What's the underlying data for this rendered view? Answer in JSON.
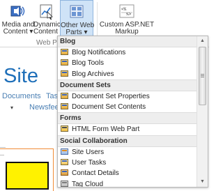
{
  "ribbon": {
    "buttons": [
      {
        "line1": "Media and",
        "line2": "Content",
        "icon": "speaker-media-icon"
      },
      {
        "line1": "Dynamic",
        "line2": "Content",
        "icon": "chart-dynamic-icon"
      },
      {
        "line1": "Other Web",
        "line2": "Parts",
        "icon": "web-parts-grid-icon"
      },
      {
        "line1": "Custom ASP.NET",
        "line2": "Markup",
        "icon": "markup-code-icon"
      }
    ],
    "dropdown_arrow": "▾",
    "group_label": "Web Parts"
  },
  "page": {
    "title_partial": "Site",
    "nav": [
      "Documents",
      "Task",
      "Newsfeed"
    ],
    "caret": "▾"
  },
  "menu": {
    "categories": [
      {
        "name": "Blog",
        "items": [
          "Blog Notifications",
          "Blog Tools",
          "Blog Archives"
        ]
      },
      {
        "name": "Document Sets",
        "items": [
          "Document Set Properties",
          "Document Set Contents"
        ]
      },
      {
        "name": "Forms",
        "items": [
          "HTML Form Web Part"
        ]
      },
      {
        "name": "Social Collaboration",
        "items": [
          "Site Users",
          "User Tasks",
          "Contact Details",
          "Tag Cloud"
        ]
      }
    ],
    "scroll_up": "▲",
    "scroll_down": "▼"
  },
  "colors": {
    "accent": "#1e6fb9",
    "ribbon_active": "#cfe3f7",
    "highlight_box": "#fff200",
    "frame_orange": "#f08b35"
  }
}
